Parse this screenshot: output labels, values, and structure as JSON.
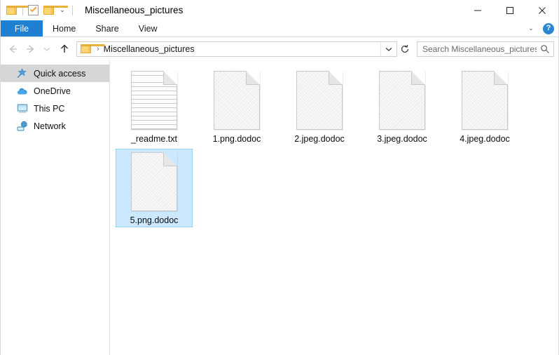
{
  "window": {
    "title": "Miscellaneous_pictures",
    "quick_access_toolbar": [
      {
        "name": "folder-icon",
        "label": ""
      },
      {
        "name": "properties-icon",
        "label": ""
      },
      {
        "name": "new-folder-icon",
        "label": ""
      },
      {
        "name": "customize-chevron",
        "label": "⌄"
      }
    ],
    "controls": {
      "minimize": "Minimize",
      "maximize": "Maximize",
      "close": "Close"
    }
  },
  "ribbon": {
    "tabs": [
      {
        "label": "File",
        "active": true
      },
      {
        "label": "Home",
        "active": false
      },
      {
        "label": "Share",
        "active": false
      },
      {
        "label": "View",
        "active": false
      }
    ],
    "expand_chevron": "⌄",
    "help_label": "?"
  },
  "address_bar": {
    "back_title": "Back",
    "forward_title": "Forward",
    "recent_title": "Recent locations",
    "up_title": "Up one level",
    "breadcrumb": {
      "folder_icon": "folder-icon",
      "separator": "›",
      "path": "Miscellaneous_pictures"
    },
    "dropdown_title": "Previous locations",
    "refresh_title": "Refresh"
  },
  "search": {
    "placeholder": "Search Miscellaneous_pictures",
    "icon": "search-icon"
  },
  "sidebar": {
    "items": [
      {
        "label": "Quick access",
        "icon": "pin-star-icon",
        "selected": true
      },
      {
        "label": "OneDrive",
        "icon": "cloud-icon",
        "selected": false
      },
      {
        "label": "This PC",
        "icon": "monitor-icon",
        "selected": false
      },
      {
        "label": "Network",
        "icon": "network-icon",
        "selected": false
      }
    ]
  },
  "files": [
    {
      "name": "_readme.txt",
      "icon": "text-document-icon",
      "selected": false
    },
    {
      "name": "1.png.dodoc",
      "icon": "generic-file-icon",
      "selected": false
    },
    {
      "name": "2.jpeg.dodoc",
      "icon": "generic-file-icon",
      "selected": false
    },
    {
      "name": "3.jpeg.dodoc",
      "icon": "generic-file-icon",
      "selected": false
    },
    {
      "name": "4.jpeg.dodoc",
      "icon": "generic-file-icon",
      "selected": false
    },
    {
      "name": "5.png.dodoc",
      "icon": "generic-file-icon",
      "selected": true
    }
  ],
  "colors": {
    "accent": "#1f7fd0",
    "selection_fill": "#cce8ff",
    "selection_border": "#99d1ff",
    "sidebar_selected": "#d6d6d6",
    "folder_yellow": "#fcd575",
    "help_blue": "#2b87d3"
  }
}
